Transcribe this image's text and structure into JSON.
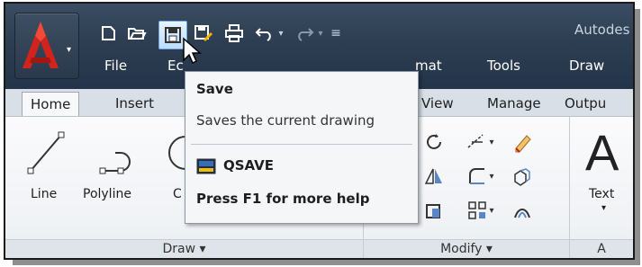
{
  "app": {
    "title_partial": "Autodes"
  },
  "menubar": {
    "items": [
      "File",
      "Ec",
      "Format",
      "Tools",
      "Draw"
    ],
    "format_partial": "mat"
  },
  "tabs": [
    {
      "label": "Home",
      "active": true
    },
    {
      "label": "Insert",
      "active": false
    },
    {
      "label": "View",
      "active": false
    },
    {
      "label": "Manage",
      "active": false
    },
    {
      "label": "Outpu",
      "active": false
    }
  ],
  "draw_panel": {
    "title": "Draw ▾",
    "tools": [
      "Line",
      "Polyline",
      "C"
    ]
  },
  "modify_panel": {
    "title": "Modify ▾"
  },
  "annotation_panel": {
    "text_tool": "Text",
    "title_partial": "A"
  },
  "tooltip": {
    "title": "Save",
    "description": "Saves the current drawing",
    "command": "QSAVE",
    "help": "Press F1 for more help"
  },
  "icons": {
    "app_logo": "autocad-a-icon",
    "qat": [
      "new-icon",
      "open-icon",
      "save-icon",
      "saveas-icon",
      "plot-icon",
      "undo-icon",
      "redo-icon",
      "qat-customize-icon"
    ]
  },
  "colors": {
    "accent": "#c8201b",
    "titlebar": "#2d3e52",
    "tab_bg": "#d9dfe6"
  }
}
